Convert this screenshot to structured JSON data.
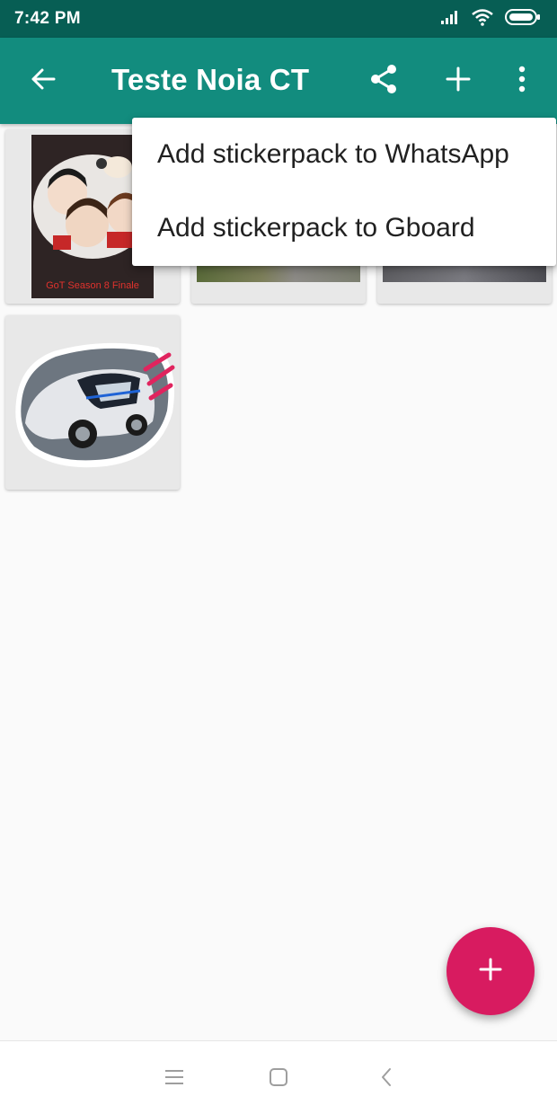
{
  "status_bar": {
    "time": "7:42 PM",
    "icons": [
      "signal-icon",
      "wifi-icon",
      "battery-icon"
    ]
  },
  "app_bar": {
    "title": "Teste Noia CT",
    "actions": [
      "back-arrow-icon",
      "share-icon",
      "plus-icon",
      "more-vert-icon"
    ]
  },
  "stickers": [
    {
      "caption": "GoT Season 8 Finale"
    },
    {
      "caption": ""
    },
    {
      "caption": ""
    },
    {
      "caption": ""
    }
  ],
  "menu": {
    "items": [
      {
        "label": "Add stickerpack to WhatsApp"
      },
      {
        "label": "Add stickerpack to Gboard"
      }
    ]
  },
  "fab": {
    "icon": "plus-icon"
  },
  "nav_bar": {
    "icons": [
      "menu-icon",
      "home-square-icon",
      "back-chevron-icon"
    ]
  },
  "colors": {
    "status_bar": "#075e54",
    "app_bar": "#128c7e",
    "fab": "#d81b60",
    "background": "#fafafa"
  }
}
